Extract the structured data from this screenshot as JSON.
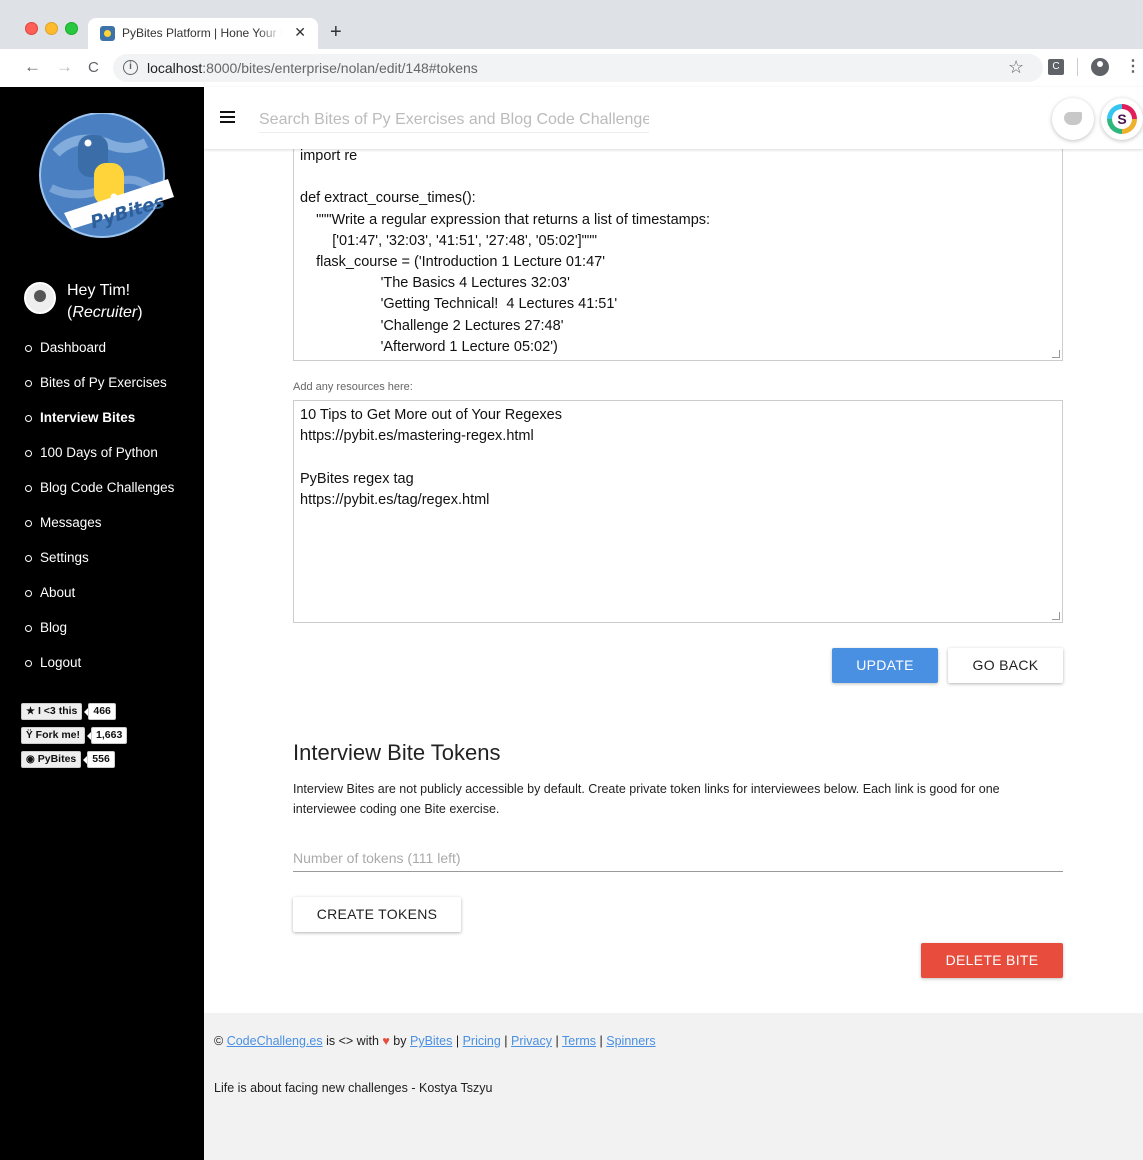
{
  "browser": {
    "tab_title": "PyBites Platform | Hone Your P",
    "tab_close": "✕",
    "new_tab": "+",
    "url_host": "localhost",
    "url_path": ":8000/bites/enterprise/nolan/edit/148#tokens",
    "back": "←",
    "forward": "→",
    "reload": "C",
    "info": "i",
    "star": "☆",
    "ext_letter": "C",
    "menu": "⋮"
  },
  "sidebar": {
    "logo_text": "PyBites",
    "greeting": "Hey Tim!",
    "role": "Recruiter",
    "nav": [
      {
        "label": "Dashboard",
        "active": false
      },
      {
        "label": "Bites of Py Exercises",
        "active": false
      },
      {
        "label": "Interview Bites",
        "active": true
      },
      {
        "label": "100 Days of Python",
        "active": false
      },
      {
        "label": "Blog Code Challenges",
        "active": false
      },
      {
        "label": "Messages",
        "active": false
      },
      {
        "label": "Settings",
        "active": false
      },
      {
        "label": "About",
        "active": false
      },
      {
        "label": "Blog",
        "active": false
      },
      {
        "label": "Logout",
        "active": false
      }
    ],
    "badges": [
      {
        "icon": "★",
        "label": "I <3 this",
        "count": "466"
      },
      {
        "icon": "Ÿ",
        "label": "Fork me!",
        "count": "1,663"
      },
      {
        "icon": "◉",
        "label": "PyBites",
        "count": "556"
      }
    ]
  },
  "header": {
    "search_placeholder": "Search Bites of Py Exercises and Blog Code Challenges"
  },
  "editor": {
    "code": "import re\n\ndef extract_course_times():\n    \"\"\"Write a regular expression that returns a list of timestamps:\n        ['01:47', '32:03', '41:51', '27:48', '05:02']\"\"\"\n    flask_course = ('Introduction 1 Lecture 01:47'\n                    'The Basics 4 Lectures 32:03'\n                    'Getting Technical!  4 Lectures 41:51'\n                    'Challenge 2 Lectures 27:48'\n                    'Afterword 1 Lecture 05:02')",
    "resources_label": "Add any resources here:",
    "resources": "10 Tips to Get More out of Your Regexes\nhttps://pybit.es/mastering-regex.html\n\nPyBites regex tag\nhttps://pybit.es/tag/regex.html",
    "update_label": "UPDATE",
    "back_label": "GO BACK"
  },
  "tokens": {
    "title": "Interview Bite Tokens",
    "description": "Interview Bites are not publicly accessible by default. Create private token links for interviewees below. Each link is good for one interviewee coding one Bite exercise.",
    "input_placeholder": "Number of tokens (111 left)",
    "create_label": "CREATE TOKENS",
    "delete_label": "DELETE BITE"
  },
  "footer": {
    "copyright": "©",
    "site_link": "CodeChalleng.es",
    "made_with": "is <> with",
    "heart": "♥",
    "by": "by",
    "pybites_link": "PyBites",
    "pricing": "Pricing",
    "privacy": "Privacy",
    "terms": "Terms",
    "spinners": "Spinners",
    "sep": "|",
    "quote": "Life is about facing new challenges - Kostya Tszyu"
  },
  "colors": {
    "primary": "#4a90e2",
    "danger": "#e74c3c",
    "sidebar_bg": "#000000",
    "footer_bg": "#f2f2f2"
  }
}
